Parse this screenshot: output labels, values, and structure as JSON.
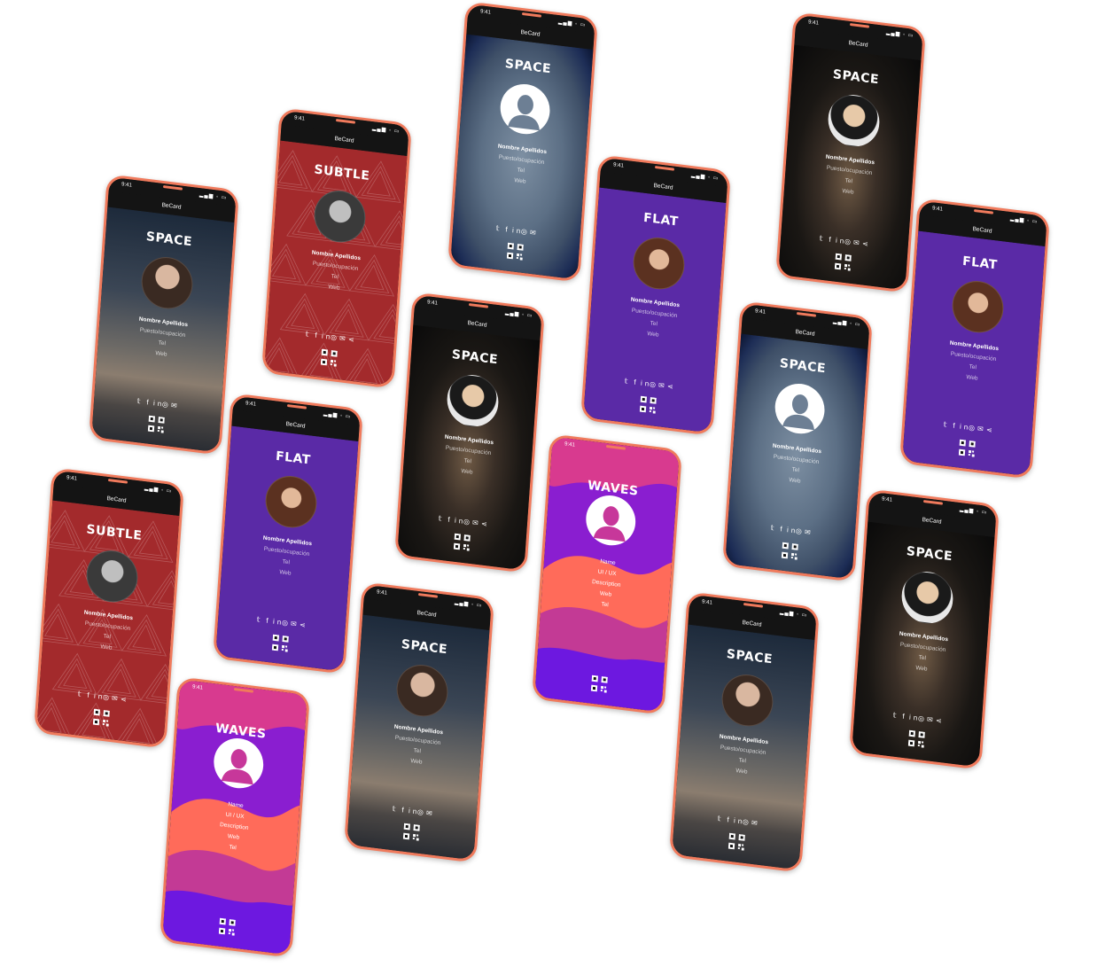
{
  "status_time": "9:41",
  "app_name": "BeCard",
  "status_signal": "▂▄▆ ◦ ▭",
  "placeholder_name": "Nombre Apellidos",
  "placeholder_job": "Puesto/ocupación",
  "placeholder_tel": "Tel",
  "placeholder_web": "Web",
  "waves_name": "Name",
  "waves_role": "UI / UX",
  "waves_desc": "Description",
  "waves_web": "Web",
  "waves_tel": "Tel",
  "socials": [
    "twitter-icon",
    "facebook-icon",
    "linkedin-icon",
    "instagram-icon",
    "mail-icon",
    "share-icon"
  ],
  "templates": {
    "space": "SPACE",
    "subtle": "SUBTLE",
    "flat": "FLAT",
    "waves": "WAVES"
  },
  "colors": {
    "frame": "#f07a5c",
    "subtle": "#a32a2c",
    "flat": "#5a2aa6"
  },
  "phones": [
    {
      "id": "p1",
      "template": "space",
      "bg": "space-rocket",
      "avatar": "man",
      "share": false
    },
    {
      "id": "p2",
      "template": "subtle",
      "bg": "subtle",
      "avatar": "gray",
      "share": true
    },
    {
      "id": "p3",
      "template": "space",
      "bg": "space-earth",
      "avatar": "generic",
      "share": false
    },
    {
      "id": "p4",
      "template": "flat",
      "bg": "flat",
      "avatar": "girl",
      "share": true
    },
    {
      "id": "p5",
      "template": "space",
      "bg": "space-stars",
      "avatar": "asian",
      "share": true
    },
    {
      "id": "p6",
      "template": "flat",
      "bg": "flat",
      "avatar": "girl",
      "share": true
    },
    {
      "id": "p7",
      "template": "space",
      "bg": "space-stars",
      "avatar": "asian",
      "share": true
    },
    {
      "id": "p8",
      "template": "space",
      "bg": "space-earth",
      "avatar": "generic",
      "share": false
    },
    {
      "id": "p9",
      "template": "subtle",
      "bg": "subtle",
      "avatar": "gray",
      "share": true
    },
    {
      "id": "p10",
      "template": "flat",
      "bg": "flat",
      "avatar": "girl",
      "share": true
    },
    {
      "id": "p11",
      "template": "waves",
      "bg": "waves",
      "avatar": "generic",
      "share": false
    },
    {
      "id": "p12",
      "template": "space",
      "bg": "space-stars",
      "avatar": "asian",
      "share": true
    },
    {
      "id": "p13",
      "template": "space",
      "bg": "space-rocket",
      "avatar": "man",
      "share": false
    },
    {
      "id": "p14",
      "template": "waves",
      "bg": "waves",
      "avatar": "generic",
      "share": false
    },
    {
      "id": "p15",
      "template": "space",
      "bg": "space-rocket",
      "avatar": "man",
      "share": false
    }
  ]
}
